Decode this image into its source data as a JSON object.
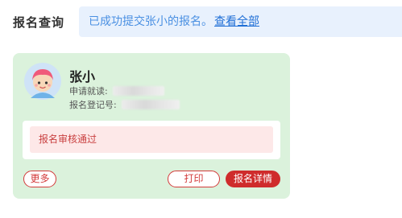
{
  "header": {
    "label": "报名查询"
  },
  "notice": {
    "text": "已成功提交张小的报名。",
    "link": "查看全部"
  },
  "card": {
    "name": "张小",
    "apply_school_label": "申请就读:",
    "reg_no_label": "报名登记号:",
    "status": "报名审核通过",
    "buttons": {
      "more": "更多",
      "print": "打印",
      "detail": "报名详情"
    }
  },
  "colors": {
    "accent_red": "#cf2c2c",
    "card_bg": "#dbf2dc",
    "notice_bg": "#e8f1fd",
    "notice_text": "#4a90e2"
  }
}
